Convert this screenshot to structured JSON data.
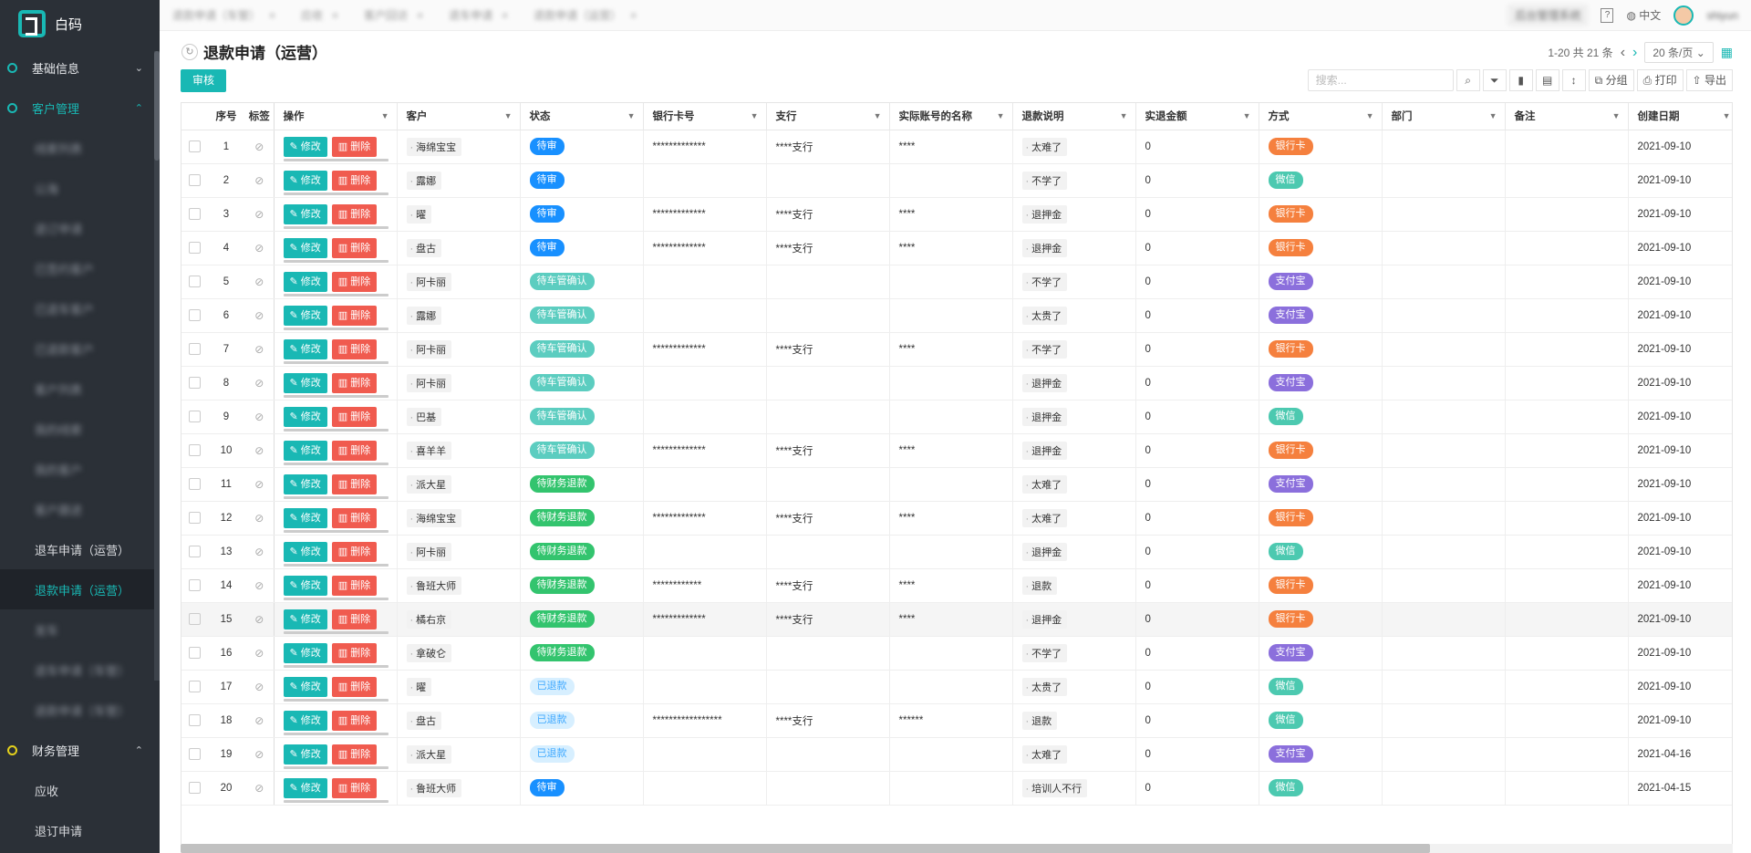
{
  "app": {
    "name": "白码"
  },
  "sidebar": {
    "groups": [
      {
        "label": "基础信息",
        "arrow": "⌄"
      },
      {
        "label": "客户管理",
        "arrow": "⌃"
      },
      {
        "label": "财务管理",
        "arrow": "⌃"
      }
    ],
    "customer_items": [
      {
        "label": "线索列表",
        "blurred": true
      },
      {
        "label": "公海",
        "blurred": true
      },
      {
        "label": "退订申请",
        "blurred": true
      },
      {
        "label": "已签约客户",
        "blurred": true
      },
      {
        "label": "已退车客户",
        "blurred": true
      },
      {
        "label": "已退款客户",
        "blurred": true
      },
      {
        "label": "客户列表",
        "blurred": true
      },
      {
        "label": "我的线索",
        "blurred": true
      },
      {
        "label": "我的客户",
        "blurred": true
      },
      {
        "label": "客户跟进",
        "blurred": true
      },
      {
        "label": "退车申请（运营）",
        "blurred": false
      },
      {
        "label": "退款申请（运营）",
        "blurred": false,
        "active": true
      },
      {
        "label": "发车",
        "blurred": true
      },
      {
        "label": "退车申请（车管）",
        "blurred": true
      },
      {
        "label": "退款申请（车管）",
        "blurred": true
      }
    ],
    "finance_items": [
      {
        "label": "应收"
      },
      {
        "label": "退订申请"
      }
    ]
  },
  "topbar": {
    "tabs": [
      "退款申请（车管）",
      "应收",
      "客户回访",
      "退车申请",
      "退款申请（运营）"
    ],
    "pill": "后台管理系统",
    "lang": "中文",
    "user": "shiyun"
  },
  "page": {
    "title": "退款申请（运营）",
    "audit_button": "审核",
    "pager": {
      "range": "1-20 共 21 条",
      "page_size": "20 条/页"
    },
    "search_placeholder": "搜索...",
    "tools": {
      "group": "分组",
      "print": "打印",
      "export": "导出"
    }
  },
  "table": {
    "headers": {
      "index": "序号",
      "tag": "标签",
      "op": "操作",
      "customer": "客户",
      "status": "状态",
      "card": "银行卡号",
      "branch": "支行",
      "account_name": "实际账号的名称",
      "reason": "退款说明",
      "amount": "实退金额",
      "method": "方式",
      "dept": "部门",
      "remark": "备注",
      "date": "创建日期"
    },
    "edit_label": "修改",
    "delete_label": "删除",
    "rows": [
      {
        "idx": "1",
        "customer": "海绵宝宝",
        "status": "待审",
        "sc": "s-wait",
        "card": "*************",
        "branch": "****支行",
        "acct": "****",
        "reason": "太难了",
        "amount": "0",
        "method": "银行卡",
        "mc": "m-bank",
        "date": "2021-09-10"
      },
      {
        "idx": "2",
        "customer": "露娜",
        "status": "待审",
        "sc": "s-wait",
        "card": "",
        "branch": "",
        "acct": "",
        "reason": "不学了",
        "amount": "0",
        "method": "微信",
        "mc": "m-wechat",
        "date": "2021-09-10"
      },
      {
        "idx": "3",
        "customer": "曜",
        "status": "待审",
        "sc": "s-wait",
        "card": "*************",
        "branch": "****支行",
        "acct": "****",
        "reason": "退押金",
        "amount": "0",
        "method": "银行卡",
        "mc": "m-bank",
        "date": "2021-09-10"
      },
      {
        "idx": "4",
        "customer": "盘古",
        "status": "待审",
        "sc": "s-wait",
        "card": "*************",
        "branch": "****支行",
        "acct": "****",
        "reason": "退押金",
        "amount": "0",
        "method": "银行卡",
        "mc": "m-bank",
        "date": "2021-09-10"
      },
      {
        "idx": "5",
        "customer": "阿卡丽",
        "status": "待车管确认",
        "sc": "s-manager",
        "card": "",
        "branch": "",
        "acct": "",
        "reason": "不学了",
        "amount": "0",
        "method": "支付宝",
        "mc": "m-alipay",
        "date": "2021-09-10"
      },
      {
        "idx": "6",
        "customer": "露娜",
        "status": "待车管确认",
        "sc": "s-manager",
        "card": "",
        "branch": "",
        "acct": "",
        "reason": "太贵了",
        "amount": "0",
        "method": "支付宝",
        "mc": "m-alipay",
        "date": "2021-09-10"
      },
      {
        "idx": "7",
        "customer": "阿卡丽",
        "status": "待车管确认",
        "sc": "s-manager",
        "card": "*************",
        "branch": "****支行",
        "acct": "****",
        "reason": "不学了",
        "amount": "0",
        "method": "银行卡",
        "mc": "m-bank",
        "date": "2021-09-10"
      },
      {
        "idx": "8",
        "customer": "阿卡丽",
        "status": "待车管确认",
        "sc": "s-manager",
        "card": "",
        "branch": "",
        "acct": "",
        "reason": "退押金",
        "amount": "0",
        "method": "支付宝",
        "mc": "m-alipay",
        "date": "2021-09-10"
      },
      {
        "idx": "9",
        "customer": "巴基",
        "status": "待车管确认",
        "sc": "s-manager",
        "card": "",
        "branch": "",
        "acct": "",
        "reason": "退押金",
        "amount": "0",
        "method": "微信",
        "mc": "m-wechat",
        "date": "2021-09-10"
      },
      {
        "idx": "10",
        "customer": "喜羊羊",
        "status": "待车管确认",
        "sc": "s-manager",
        "card": "*************",
        "branch": "****支行",
        "acct": "****",
        "reason": "退押金",
        "amount": "0",
        "method": "银行卡",
        "mc": "m-bank",
        "date": "2021-09-10"
      },
      {
        "idx": "11",
        "customer": "派大星",
        "status": "待财务退款",
        "sc": "s-finance",
        "card": "",
        "branch": "",
        "acct": "",
        "reason": "太难了",
        "amount": "0",
        "method": "支付宝",
        "mc": "m-alipay",
        "date": "2021-09-10"
      },
      {
        "idx": "12",
        "customer": "海绵宝宝",
        "status": "待财务退款",
        "sc": "s-finance",
        "card": "*************",
        "branch": "****支行",
        "acct": "****",
        "reason": "太难了",
        "amount": "0",
        "method": "银行卡",
        "mc": "m-bank",
        "date": "2021-09-10"
      },
      {
        "idx": "13",
        "customer": "阿卡丽",
        "status": "待财务退款",
        "sc": "s-finance",
        "card": "",
        "branch": "",
        "acct": "",
        "reason": "退押金",
        "amount": "0",
        "method": "微信",
        "mc": "m-wechat",
        "date": "2021-09-10"
      },
      {
        "idx": "14",
        "customer": "鲁班大师",
        "status": "待财务退款",
        "sc": "s-finance",
        "card": "************",
        "branch": "****支行",
        "acct": "****",
        "reason": "退款",
        "amount": "0",
        "method": "银行卡",
        "mc": "m-bank",
        "date": "2021-09-10"
      },
      {
        "idx": "15",
        "customer": "橘右京",
        "status": "待财务退款",
        "sc": "s-finance",
        "card": "*************",
        "branch": "****支行",
        "acct": "****",
        "reason": "退押金",
        "amount": "0",
        "method": "银行卡",
        "mc": "m-bank",
        "date": "2021-09-10",
        "hl": true
      },
      {
        "idx": "16",
        "customer": "拿破仑",
        "status": "待财务退款",
        "sc": "s-finance",
        "card": "",
        "branch": "",
        "acct": "",
        "reason": "不学了",
        "amount": "0",
        "method": "支付宝",
        "mc": "m-alipay",
        "date": "2021-09-10"
      },
      {
        "idx": "17",
        "customer": "曜",
        "status": "已退款",
        "sc": "s-done",
        "card": "",
        "branch": "",
        "acct": "",
        "reason": "太贵了",
        "amount": "0",
        "method": "微信",
        "mc": "m-wechat",
        "date": "2021-09-10"
      },
      {
        "idx": "18",
        "customer": "盘古",
        "status": "已退款",
        "sc": "s-done",
        "card": "*****************",
        "branch": "****支行",
        "acct": "******",
        "reason": "退款",
        "amount": "0",
        "method": "微信",
        "mc": "m-wechat",
        "date": "2021-09-10"
      },
      {
        "idx": "19",
        "customer": "派大星",
        "status": "已退款",
        "sc": "s-done",
        "card": "",
        "branch": "",
        "acct": "",
        "reason": "太难了",
        "amount": "0",
        "method": "支付宝",
        "mc": "m-alipay",
        "date": "2021-04-16"
      },
      {
        "idx": "20",
        "customer": "鲁班大师",
        "status": "待审",
        "sc": "s-wait",
        "card": "",
        "branch": "",
        "acct": "",
        "reason": "培训人不行",
        "amount": "0",
        "method": "微信",
        "mc": "m-wechat",
        "date": "2021-04-15"
      }
    ]
  }
}
